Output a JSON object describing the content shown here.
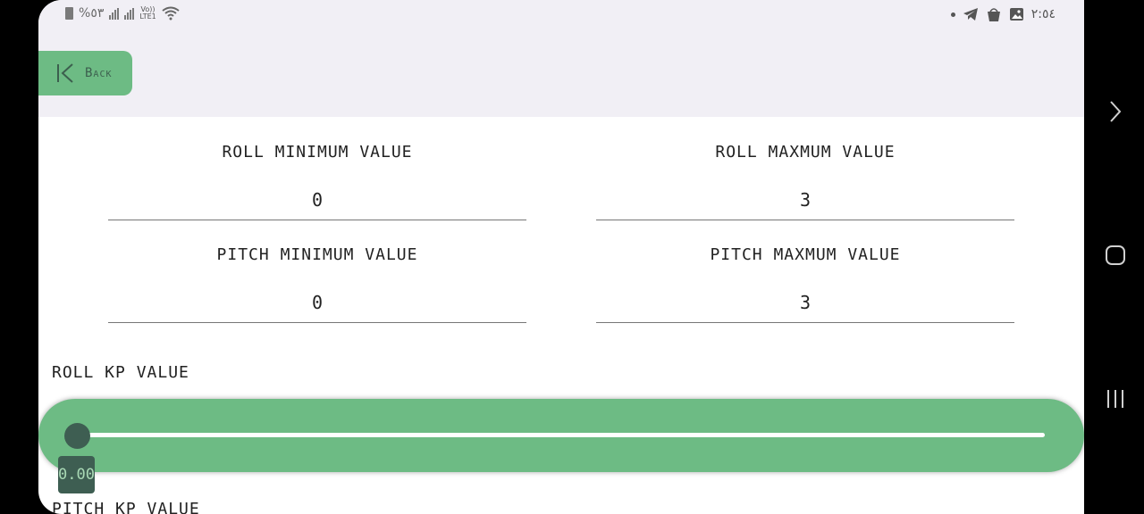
{
  "status_bar": {
    "battery_text": "%٥٣",
    "lte_top": "Vo))",
    "lte_bottom": "LTE1",
    "time": "٢:٥٤"
  },
  "header": {
    "back_label": "Back"
  },
  "fields": {
    "roll_min": {
      "label": "ROLL MINIMUM VALUE",
      "value": "0"
    },
    "roll_max": {
      "label": "ROLL MAXMUM VALUE",
      "value": "3"
    },
    "pitch_min": {
      "label": "PITCH MINIMUM VALUE",
      "value": "0"
    },
    "pitch_max": {
      "label": "PITCH MAXMUM VALUE",
      "value": "3"
    }
  },
  "roll_kp": {
    "label": "ROLL KP VALUE",
    "value_text": "0.00",
    "slider_fraction": 0.0
  },
  "pitch_kp": {
    "label": "PITCH KP VALUE"
  },
  "colors": {
    "accent_green": "#6dbb84",
    "thumb_dark": "#3e5e52",
    "header_bg": "#f1eff5"
  },
  "icons": {
    "back": "back-chevron-icon",
    "nav_next": "chevron-right-icon",
    "nav_home": "home-square-icon",
    "nav_recents": "recents-icon"
  }
}
